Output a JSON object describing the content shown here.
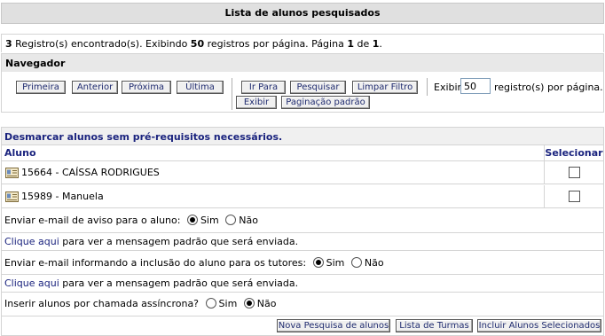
{
  "header": {
    "title": "Lista de alunos pesquisados"
  },
  "info": {
    "count": "3",
    "text1": " Registro(s) encontrado(s). Exibindo ",
    "per_page": "50",
    "text2": " registros por página. Página ",
    "page": "1",
    "text3": " de ",
    "total_pages": "1",
    "text4": "."
  },
  "navigator": {
    "title": "Navegador",
    "buttons": {
      "first": "Primeira",
      "previous": "Anterior",
      "next": "Próxima",
      "last": "Última",
      "goto": "Ir Para",
      "search": "Pesquisar",
      "clear_filter": "Limpar Filtro",
      "show": "Exibir",
      "default_paging": "Paginação padrão"
    },
    "show_label": "Exibir",
    "show_value": "50",
    "show_suffix": "registro(s) por página."
  },
  "students": {
    "section_title": "Desmarcar alunos sem pré-requisitos necessários.",
    "col_student": "Aluno",
    "col_select": "Selecionar",
    "rows": [
      {
        "label": "15664 - CAÍSSA RODRIGUES",
        "selected": false
      },
      {
        "label": "15989 - Manuela",
        "selected": false
      }
    ]
  },
  "options": {
    "email_student": {
      "label": "Enviar e-mail de aviso para o aluno:",
      "yes": "Sim",
      "no": "Não",
      "value": "Sim"
    },
    "click_here_1": {
      "link": "Clique aqui",
      "text": " para ver a mensagem padrão que será enviada."
    },
    "email_tutors": {
      "label": "Enviar e-mail informando a inclusão do aluno para os tutores:",
      "yes": "Sim",
      "no": "Não",
      "value": "Sim"
    },
    "click_here_2": {
      "link": "Clique aqui",
      "text": " para ver a mensagem padrão que será enviada."
    },
    "async_call": {
      "label": "Inserir alunos por chamada assíncrona?",
      "yes": "Sim",
      "no": "Não",
      "value": "Não"
    }
  },
  "footer_buttons": {
    "new_search": "Nova Pesquisa de alunos",
    "class_list": "Lista de Turmas",
    "include_selected": "Incluir Alunos Selecionados"
  },
  "icons": {
    "student": "id-card-icon"
  }
}
